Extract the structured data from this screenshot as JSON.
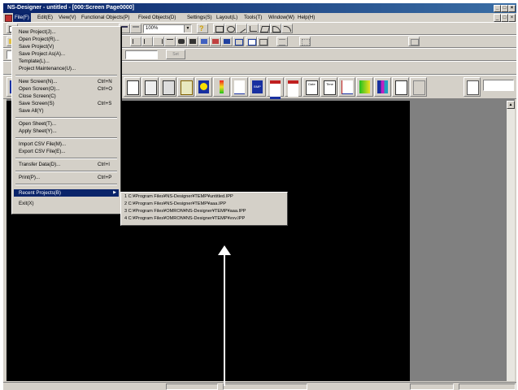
{
  "window": {
    "title": "NS-Designer - untitled - [000:Screen Page0000]"
  },
  "titlebar_buttons": [
    "_",
    "□",
    "×"
  ],
  "mdi_buttons": [
    "_",
    "□",
    "×"
  ],
  "menubar": {
    "items": [
      {
        "label": "File(F)",
        "active": true
      },
      {
        "label": "Edit(E)"
      },
      {
        "label": "View(V)"
      },
      {
        "label": "Functional Objects(P)"
      },
      {
        "label": "Fixed Objects(D)"
      },
      {
        "label": "Settings(S)"
      },
      {
        "label": "Layout(L)"
      },
      {
        "label": "Tools(T)"
      },
      {
        "label": "Window(W)"
      },
      {
        "label": "Help(H)"
      }
    ]
  },
  "toolbar": {
    "zoom_value": "100%",
    "disabled_button_label": "Set"
  },
  "file_menu": {
    "groups": [
      [
        {
          "label": "New Project(J)..."
        },
        {
          "label": "Open Project(R)..."
        },
        {
          "label": "Save Project(V)"
        },
        {
          "label": "Save Project As(A)..."
        },
        {
          "label": "Template(L)..."
        },
        {
          "label": "Project Maintenance(U)..."
        }
      ],
      [
        {
          "label": "New Screen(N)...",
          "shortcut": "Ctrl+N"
        },
        {
          "label": "Open Screen(O)...",
          "shortcut": "Ctrl+O"
        },
        {
          "label": "Close Screen(C)"
        },
        {
          "label": "Save Screen(S)",
          "shortcut": "Ctrl+S"
        },
        {
          "label": "Save All(Y)"
        }
      ],
      [
        {
          "label": "Open Sheet(T)..."
        },
        {
          "label": "Apply Sheet(Y)..."
        }
      ],
      [
        {
          "label": "Import CSV File(M)..."
        },
        {
          "label": "Export CSV File(E)..."
        }
      ],
      [
        {
          "label": "Transfer Data(D)...",
          "shortcut": "Ctrl+I"
        }
      ],
      [
        {
          "label": "Print(P)...",
          "shortcut": "Ctrl+P"
        }
      ],
      [
        {
          "label": "Recent Projects(B)",
          "submenu": true,
          "highlighted": true
        },
        {
          "label": "Exit(X)"
        }
      ]
    ]
  },
  "recent_projects": [
    "1 C:¥Program Files¥NS-Designer¥TEMP¥untitled.IPP",
    "2 C:¥Program Files¥NS-Designer¥TEMP¥aaa.IPP",
    "3 C:¥Program Files¥OMRON¥NS-Designer¥TEMP¥aaa.IPP",
    "4 C:¥Program Files¥OMRON¥NS-Designer¥TEMP¥vvv.IPP"
  ],
  "statusbar": {
    "cells": [
      "",
      "",
      "",
      ""
    ]
  },
  "colors": {
    "titlebar": "#0a246a",
    "face": "#d4d0c8",
    "canvas": "#000000",
    "highlight": "#0a246a"
  }
}
